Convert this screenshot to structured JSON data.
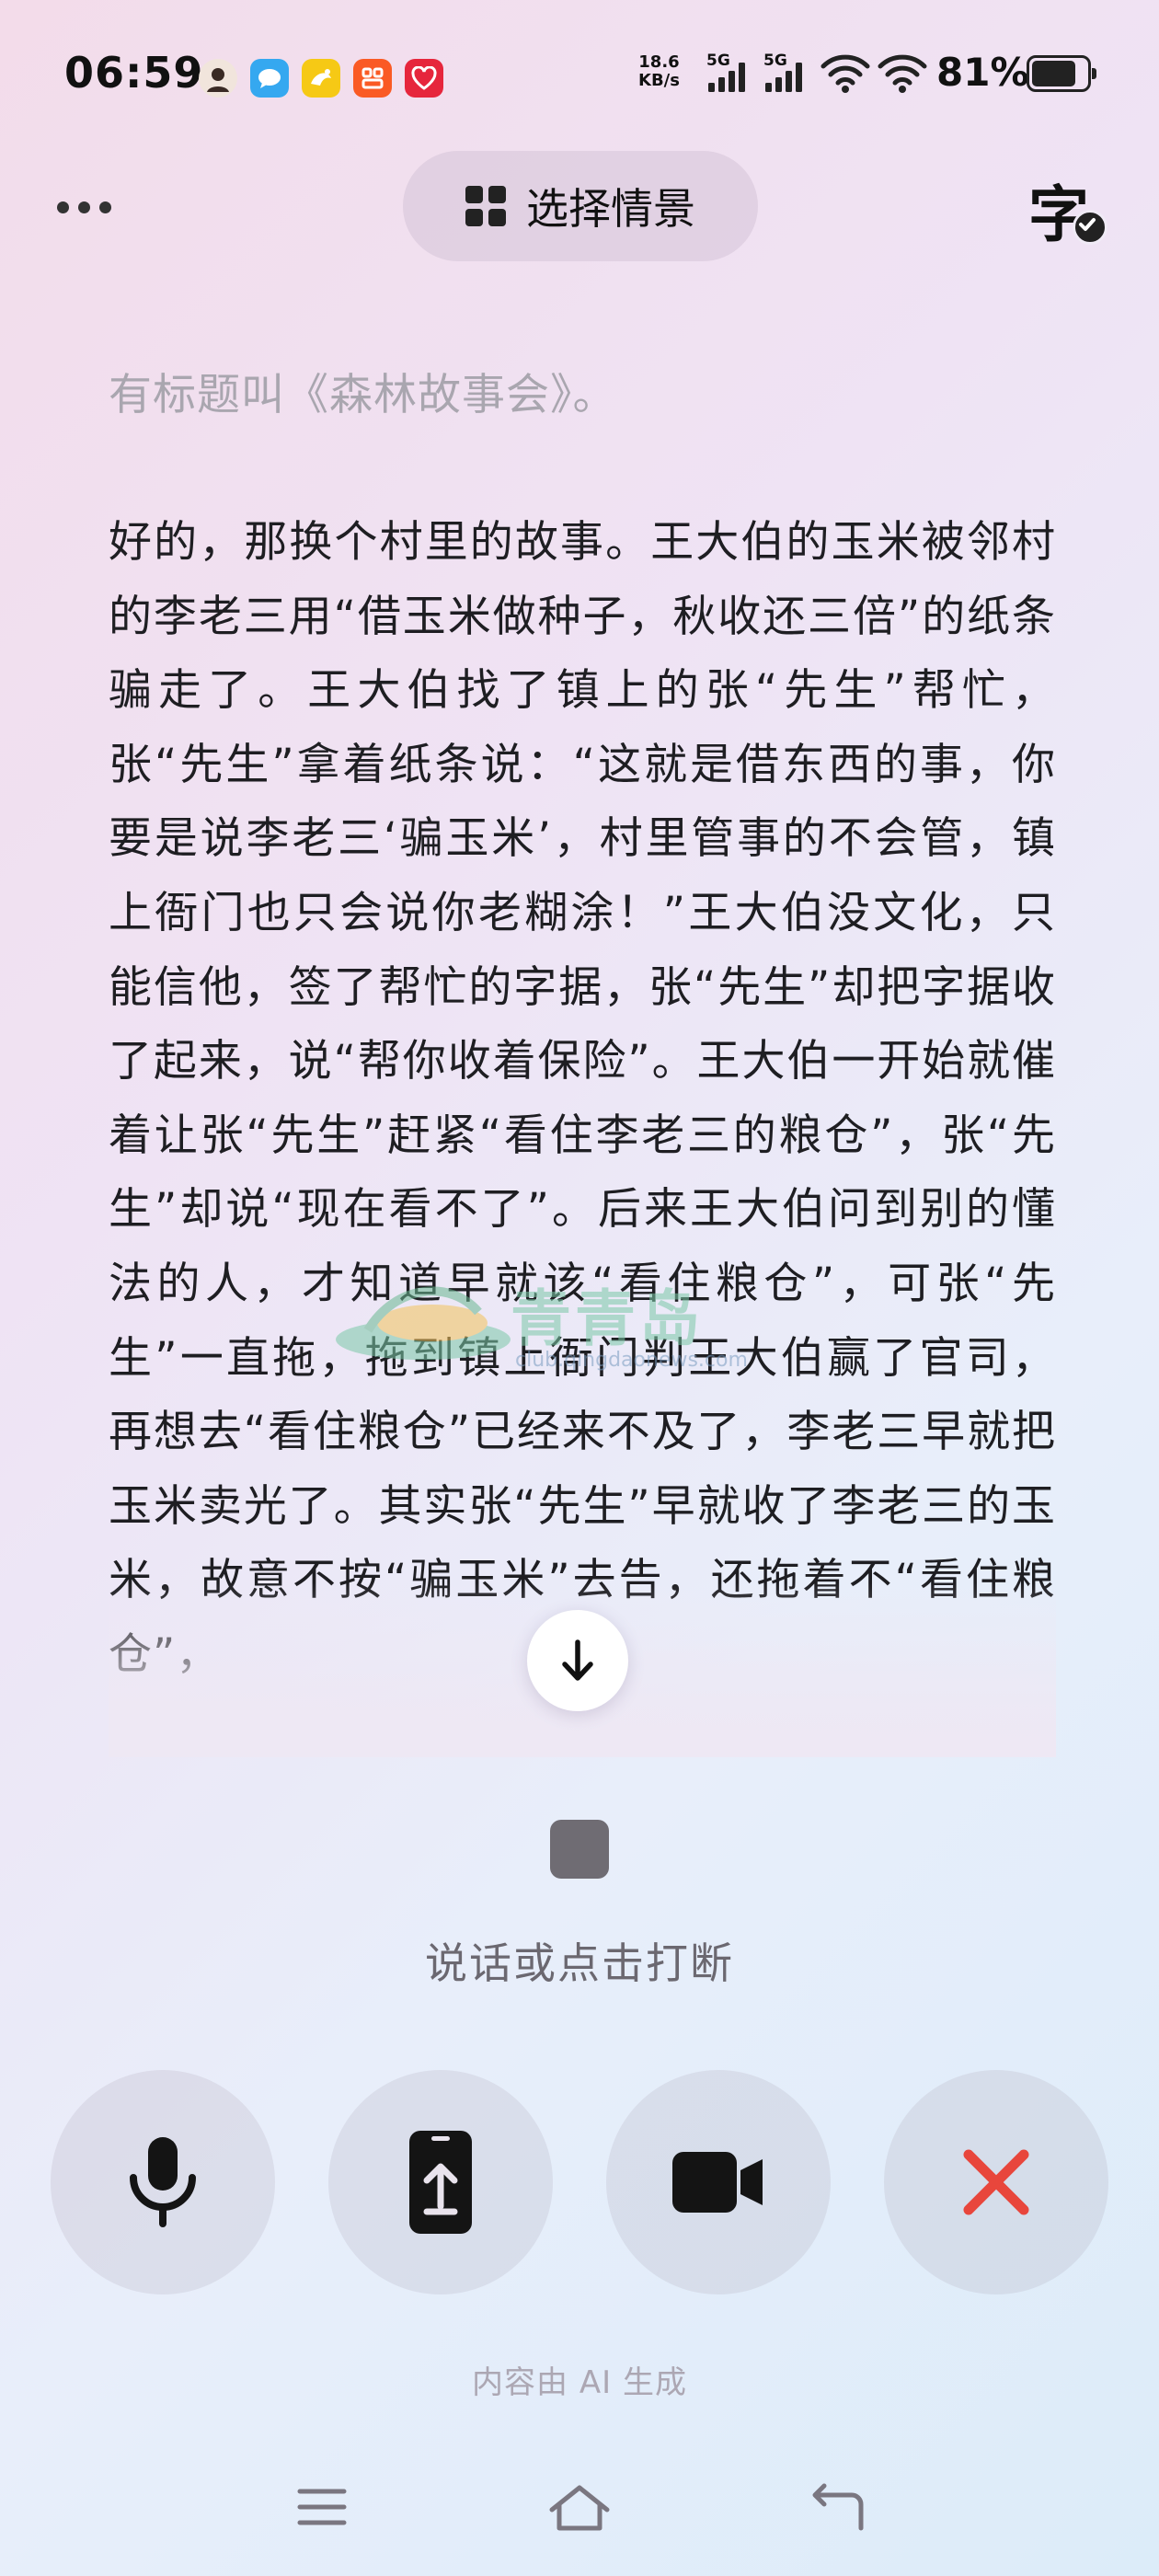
{
  "status_bar": {
    "time": "06:59",
    "net_speed_value": "18.6",
    "net_speed_unit": "KB/s",
    "signal_1_label": "5G",
    "signal_2_label": "5G",
    "battery_percent": "81%",
    "battery_level": 0.81,
    "app_icons": [
      "avatar-app-icon",
      "chat-app-icon",
      "delivery-app-icon",
      "shopping-app-icon",
      "heart-app-icon"
    ]
  },
  "toolbar": {
    "scene_label": "选择情景",
    "subtitle_glyph": "字"
  },
  "conversation": {
    "previous_line": "有标题叫《森林故事会》。",
    "reply": "好的，那换个村里的故事。王大伯的玉米被邻村的李老三用“借玉米做种子，秋收还三倍”的纸条骗走了。王大伯找了镇上的张“先生”帮忙，张“先生”拿着纸条说：“这就是借东西的事，你要是说李老三‘骗玉米’，村里管事的不会管，镇上衙门也只会说你老糊涂！”王大伯没文化，只能信他，签了帮忙的字据，张“先生”却把字据收了起来，说“帮你收着保险”。王大伯一开始就催着让张“先生”赶紧“看住李老三的粮仓”，张“先生”却说“现在看不了”。后来王大伯问到别的懂法的人，才知道早就该“看住粮仓”，可张“先生”一直拖，拖到镇上衙门判王大伯赢了官司，再想去“看住粮仓”已经来不及了，李老三早就把玉米卖光了。其实张“先生”早就收了李老三的玉米，故意不按“骗玉米”去告，还拖着不“看住粮仓”，"
  },
  "watermark": {
    "text": "青青岛",
    "url": "club.qingdaonews.com"
  },
  "hint": "说话或点击打断",
  "controls": {
    "mic": "microphone-icon",
    "share": "share-screen-icon",
    "camera": "video-camera-icon",
    "close": "close-icon",
    "close_color": "#e8463c"
  },
  "ai_note": "内容由 AI 生成"
}
